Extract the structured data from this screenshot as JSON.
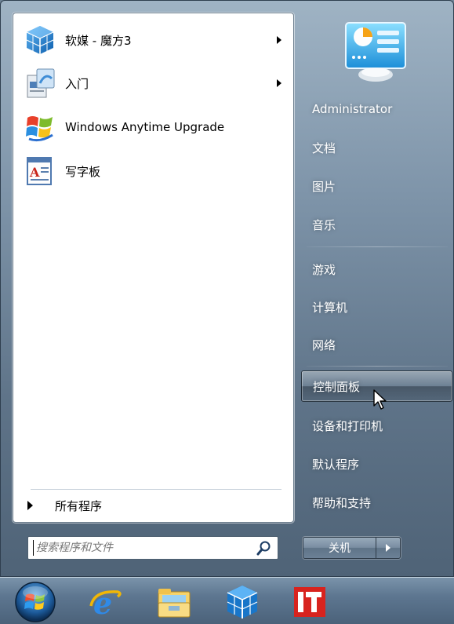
{
  "start_menu": {
    "programs": [
      {
        "label": "软媒 - 魔方3",
        "icon": "rubiks-cube-icon",
        "has_submenu": true
      },
      {
        "label": "入门",
        "icon": "getting-started-icon",
        "has_submenu": true
      },
      {
        "label": "Windows Anytime Upgrade",
        "icon": "windows-flag-icon",
        "has_submenu": false
      },
      {
        "label": "写字板",
        "icon": "wordpad-icon",
        "has_submenu": false
      }
    ],
    "all_programs_label": "所有程序",
    "search": {
      "placeholder": "搜索程序和文件",
      "value": "",
      "icon": "search-icon"
    },
    "right_items": [
      {
        "label": "Administrator"
      },
      {
        "label": "文档"
      },
      {
        "label": "图片"
      },
      {
        "label": "音乐"
      },
      {
        "label": "游戏"
      },
      {
        "label": "计算机"
      },
      {
        "label": "网络"
      },
      {
        "label": "控制面板",
        "hovered": true
      },
      {
        "label": "设备和打印机"
      },
      {
        "label": "默认程序"
      },
      {
        "label": "帮助和支持"
      }
    ],
    "user_picture": "control-panel-picture-icon",
    "shutdown_label": "关机",
    "shutdown_options_icon": "triangle-right-icon"
  },
  "taskbar": {
    "items": [
      {
        "name": "start-orb",
        "icon": "windows-orb-icon"
      },
      {
        "name": "internet-explorer",
        "icon": "ie-icon"
      },
      {
        "name": "windows-explorer",
        "icon": "folder-icon"
      },
      {
        "name": "rubiks-cube",
        "icon": "rubiks-cube-icon"
      },
      {
        "name": "ithome",
        "icon": "it-logo-icon"
      }
    ]
  },
  "colors": {
    "menu_bg": "#7d93a8",
    "panel_bg": "#ffffff",
    "taskbar_bg": "#5d7690",
    "it_red": "#d8231e"
  }
}
